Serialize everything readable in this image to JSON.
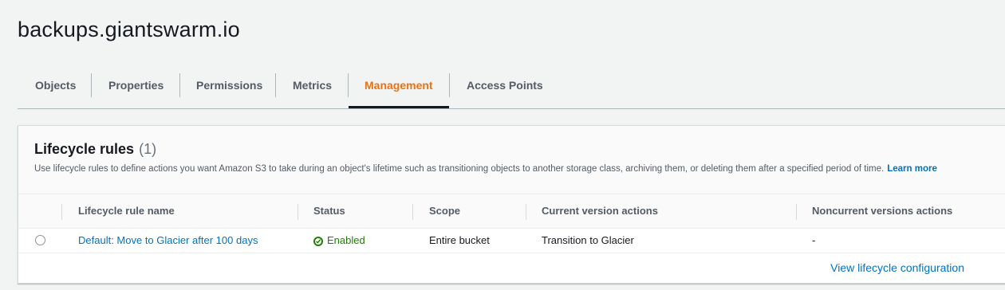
{
  "bucket": {
    "name": "backups.giantswarm.io"
  },
  "tabs": [
    {
      "label": "Objects"
    },
    {
      "label": "Properties"
    },
    {
      "label": "Permissions"
    },
    {
      "label": "Metrics"
    },
    {
      "label": "Management"
    },
    {
      "label": "Access Points"
    }
  ],
  "active_tab": "Management",
  "lifecycle": {
    "title": "Lifecycle rules",
    "count": "(1)",
    "description": "Use lifecycle rules to define actions you want Amazon S3 to take during an object's lifetime such as transitioning objects to another storage class, archiving them, or deleting them after a specified period of time.",
    "learn_more": "Learn more",
    "columns": [
      "Lifecycle rule name",
      "Status",
      "Scope",
      "Current version actions",
      "Noncurrent versions actions"
    ],
    "rows": [
      {
        "name": "Default: Move to Glacier after 100 days",
        "status": "Enabled",
        "scope": "Entire bucket",
        "current_actions": "Transition to Glacier",
        "noncurrent_actions": "-"
      }
    ],
    "view_config": "View lifecycle configuration"
  },
  "colors": {
    "accent": "#ec7211",
    "link": "#0073bb",
    "success": "#1d8102",
    "background": "#f2f3f3"
  }
}
